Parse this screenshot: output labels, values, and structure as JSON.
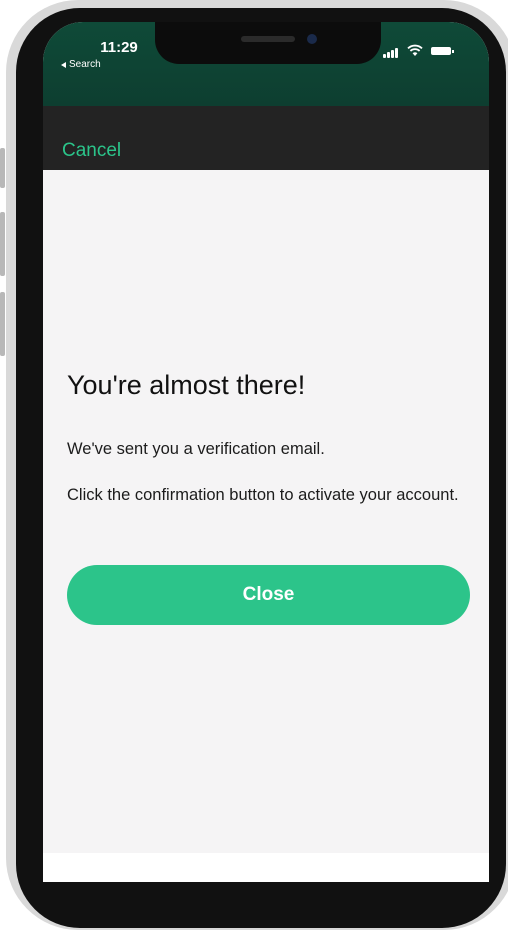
{
  "status_bar": {
    "time": "11:29",
    "back_label": "Search",
    "icons": [
      "signal-icon",
      "wifi-icon",
      "battery-icon"
    ]
  },
  "nav": {
    "cancel_label": "Cancel"
  },
  "message": {
    "heading": "You're almost there!",
    "line1": "We've sent you a verification email.",
    "line2": "Click the confirmation button to activate your account."
  },
  "actions": {
    "close_label": "Close"
  },
  "colors": {
    "accent": "#2cc48a",
    "status_bar": "#0f4a38",
    "nav_bar": "#232323",
    "background": "#f5f4f5"
  }
}
